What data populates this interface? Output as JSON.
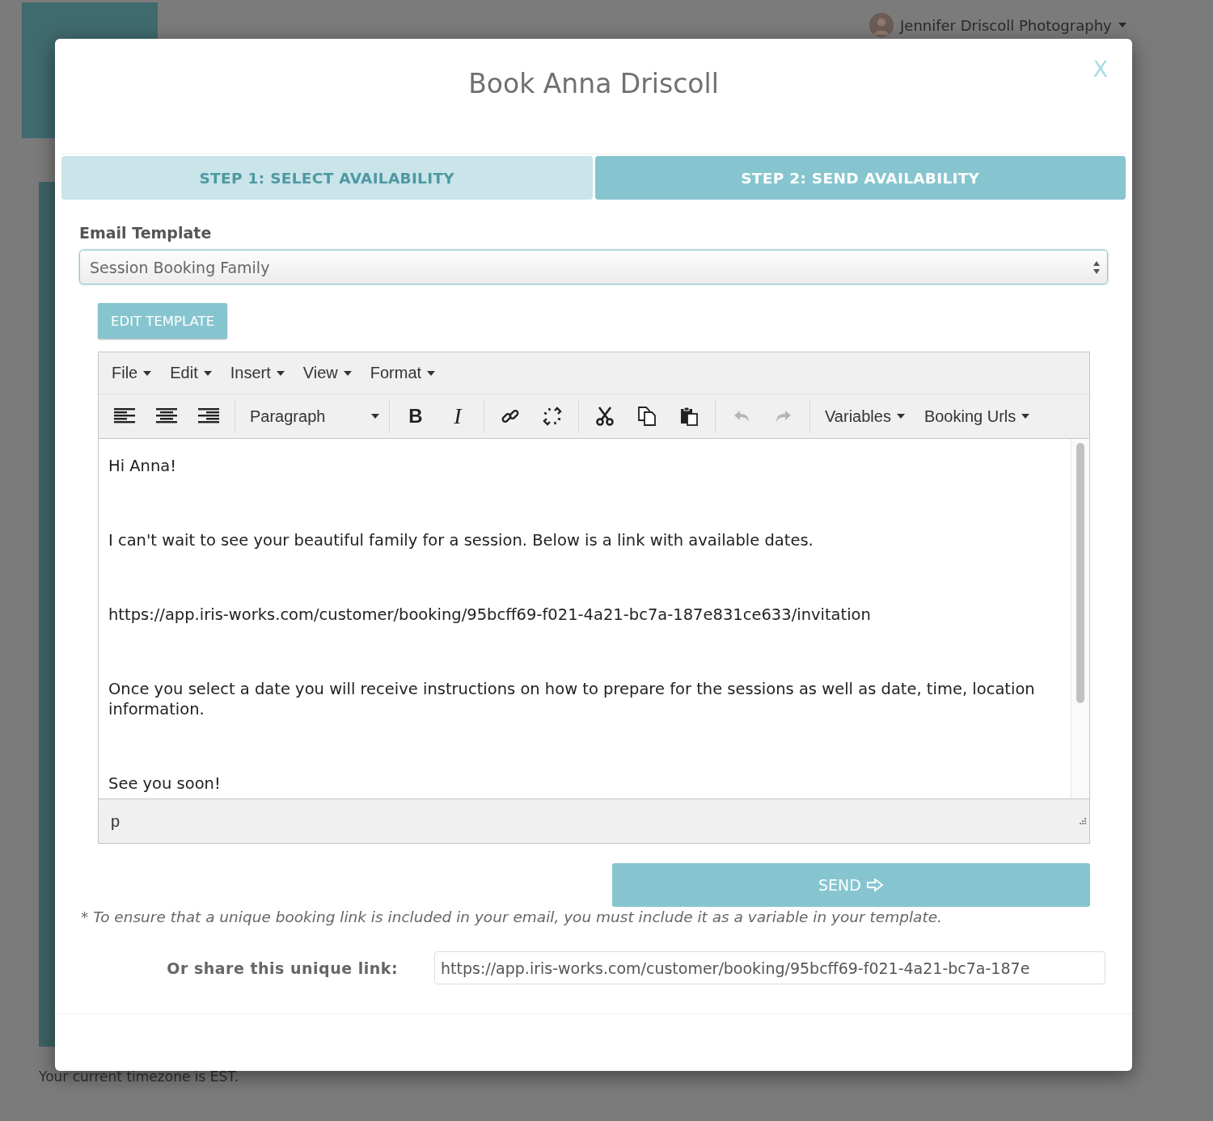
{
  "background": {
    "user_menu": "Jennifer Driscoll Photography",
    "footer": "Your current timezone is EST."
  },
  "modal": {
    "title": "Book Anna Driscoll",
    "close": "X",
    "steps": [
      {
        "label": "STEP 1: SELECT AVAILABILITY",
        "selected": false
      },
      {
        "label": "STEP 2: SEND AVAILABILITY",
        "selected": true
      }
    ],
    "template_label": "Email Template",
    "template_value": "Session Booking Family",
    "edit_button": "EDIT TEMPLATE",
    "editor": {
      "menus": [
        "File",
        "Edit",
        "Insert",
        "View",
        "Format"
      ],
      "block_format": "Paragraph",
      "bold": "B",
      "italic": "I",
      "undo": {
        "disabled": true
      },
      "redo": {
        "disabled": true
      },
      "dropdowns": [
        "Variables",
        "Booking Urls"
      ],
      "paragraphs": [
        "Hi Anna!",
        "I can't wait to see your beautiful family for a session.  Below is a link with available dates.",
        "https://app.iris-works.com/customer/booking/95bcff69-f021-4a21-bc7a-187e831ce633/invitation",
        "Once you select a date you will receive instructions on how to prepare for the sessions as well as date, time, location information.",
        "See you soon!"
      ],
      "path": "p"
    },
    "send_button": "SEND",
    "note": "* To ensure that a unique booking link is included in your email, you must include it as a variable in your template.",
    "share_label": "Or share this unique link:",
    "share_value": "https://app.iris-works.com/customer/booking/95bcff69-f021-4a21-bc7a-187e"
  }
}
